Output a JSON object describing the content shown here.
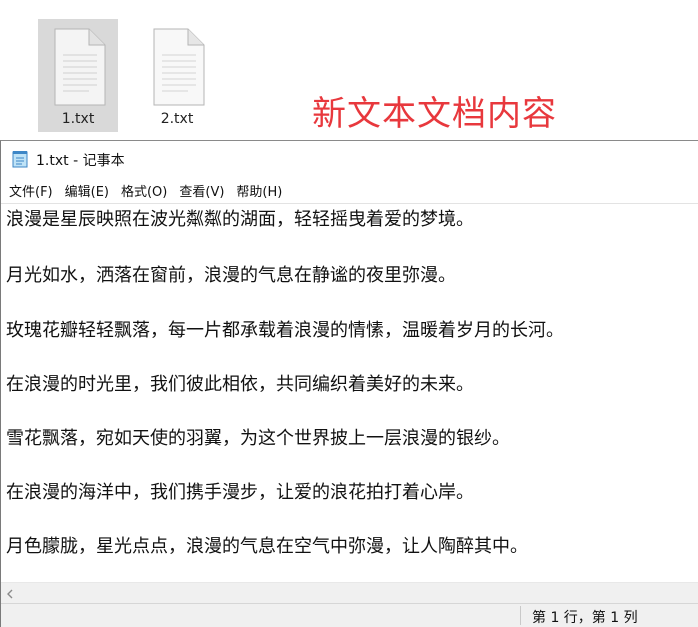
{
  "explorer": {
    "files": [
      {
        "name": "1.txt",
        "selected": true
      },
      {
        "name": "2.txt",
        "selected": false
      }
    ],
    "annotation": "新文本文档内容",
    "annotation_color": "#e8383d"
  },
  "notepad": {
    "title": "1.txt - 记事本",
    "icon": "notepad-icon",
    "menu": [
      {
        "label": "文件(F)"
      },
      {
        "label": "编辑(E)"
      },
      {
        "label": "格式(O)"
      },
      {
        "label": "查看(V)"
      },
      {
        "label": "帮助(H)"
      }
    ],
    "lines": [
      "浪漫是星辰映照在波光粼粼的湖面，轻轻摇曳着爱的梦境。",
      "月光如水，洒落在窗前，浪漫的气息在静谧的夜里弥漫。",
      "玫瑰花瓣轻轻飘落，每一片都承载着浪漫的情愫，温暖着岁月的长河。",
      "在浪漫的时光里，我们彼此相依，共同编织着美好的未来。",
      "雪花飘落，宛如天使的羽翼，为这个世界披上一层浪漫的银纱。",
      "在浪漫的海洋中，我们携手漫步，让爱的浪花拍打着心岸。",
      "月色朦胧，星光点点，浪漫的气息在空气中弥漫，让人陶醉其中。"
    ],
    "status": {
      "position": "第 1 行，第 1 列"
    }
  }
}
